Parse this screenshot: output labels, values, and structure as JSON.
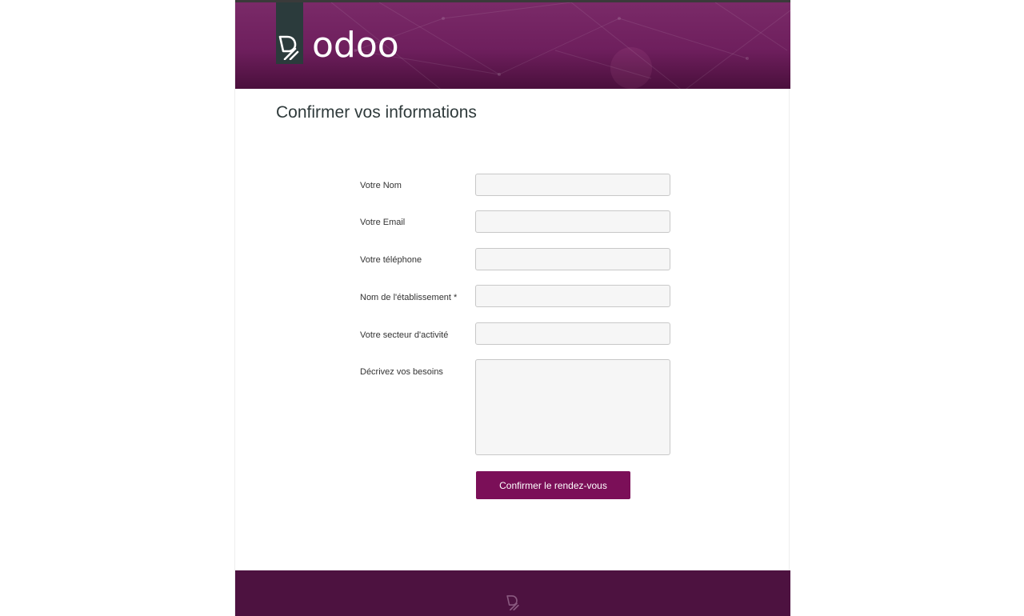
{
  "brand": {
    "name": "odoo",
    "header_color": "#6e1f5d",
    "footer_color": "#4d1240",
    "accent_color": "#7b0f58"
  },
  "page": {
    "title": "Confirmer vos informations"
  },
  "form": {
    "fields": [
      {
        "label": "Votre Nom",
        "value": "",
        "type": "text"
      },
      {
        "label": "Votre Email",
        "value": "",
        "type": "email"
      },
      {
        "label": "Votre téléphone",
        "value": "",
        "type": "tel"
      },
      {
        "label": "Nom de l'établissement *",
        "value": "",
        "type": "text"
      },
      {
        "label": "Votre secteur d'activité",
        "value": "",
        "type": "text"
      },
      {
        "label": "Décrivez vos besoins",
        "value": "",
        "type": "textarea"
      }
    ],
    "submit_label": "Confirmer le rendez-vous"
  },
  "icons": {
    "header_logo": "odoo-logo-icon",
    "footer_logo": "odoo-footer-logo-icon"
  }
}
